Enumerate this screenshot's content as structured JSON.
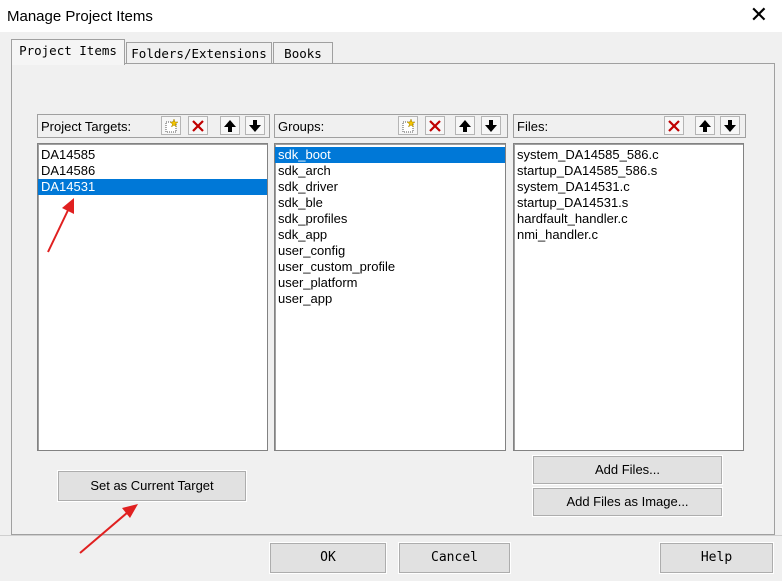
{
  "window": {
    "title": "Manage Project Items",
    "close_glyph": "✕"
  },
  "tabs": [
    {
      "label": "Project Items"
    },
    {
      "label": "Folders/Extensions"
    },
    {
      "label": "Books"
    }
  ],
  "targets": {
    "header": "Project Targets:",
    "items": [
      "DA14585",
      "DA14586",
      "DA14531"
    ],
    "selected_index": 2
  },
  "groups": {
    "header": "Groups:",
    "items": [
      "sdk_boot",
      "sdk_arch",
      "sdk_driver",
      "sdk_ble",
      "sdk_profiles",
      "sdk_app",
      "user_config",
      "user_custom_profile",
      "user_platform",
      "user_app"
    ],
    "selected_index": 0
  },
  "files": {
    "header": "Files:",
    "items": [
      "system_DA14585_586.c",
      "startup_DA14585_586.s",
      "system_DA14531.c",
      "startup_DA14531.s",
      "hardfault_handler.c",
      "nmi_handler.c"
    ]
  },
  "buttons": {
    "set_current_target": "Set as Current Target",
    "add_files": "Add Files...",
    "add_files_as_image": "Add Files as Image...",
    "ok": "OK",
    "cancel": "Cancel",
    "help": "Help"
  },
  "colors": {
    "selection": "#0078d7",
    "annotation_arrow": "#e02020"
  }
}
